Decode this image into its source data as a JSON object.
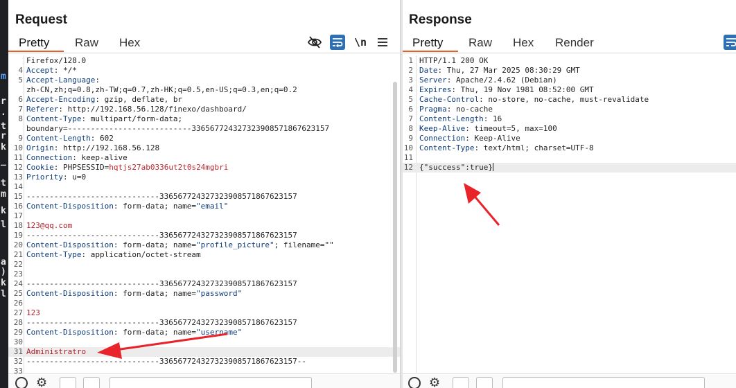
{
  "request": {
    "title": "Request",
    "tabs": [
      "Pretty",
      "Raw",
      "Hex"
    ],
    "active_tab": "Pretty",
    "lines": [
      {
        "n": "",
        "k": "",
        "v": "Firefox/128.0"
      },
      {
        "n": "4",
        "k": "Accept",
        "v": ": */*"
      },
      {
        "n": "5",
        "k": "Accept-Language",
        "v": ":"
      },
      {
        "n": "",
        "k": "",
        "v": "zh-CN,zh;q=0.8,zh-TW;q=0.7,zh-HK;q=0.5,en-US;q=0.3,en;q=0.2"
      },
      {
        "n": "6",
        "k": "Accept-Encoding",
        "v": ": gzip, deflate, br"
      },
      {
        "n": "7",
        "k": "Referer",
        "v": ": http://192.168.56.128/finexo/dashboard/"
      },
      {
        "n": "8",
        "k": "Content-Type",
        "v": ": multipart/form-data;"
      },
      {
        "n": "",
        "k": "",
        "v": "boundary=---------------------------336567724327323908571867623157"
      },
      {
        "n": "9",
        "k": "Content-Length",
        "v": ": 602"
      },
      {
        "n": "10",
        "k": "Origin",
        "v": ": http://192.168.56.128"
      },
      {
        "n": "11",
        "k": "Connection",
        "v": ": keep-alive"
      },
      {
        "n": "12",
        "k": "Cookie",
        "v": ": PHPSESSID=",
        "c": "hqtjs27ab0336ut2t0s24mgbri"
      },
      {
        "n": "13",
        "k": "Priority",
        "v": ": u=0"
      },
      {
        "n": "14",
        "k": "",
        "v": ""
      },
      {
        "n": "15",
        "k": "",
        "v": "-----------------------------336567724327323908571867623157"
      },
      {
        "n": "16",
        "k": "Content-Disposition",
        "v": ": form-data; name=",
        "q": "\"email\""
      },
      {
        "n": "17",
        "k": "",
        "v": ""
      },
      {
        "n": "18",
        "k": "",
        "v": "",
        "r": "123@qq.com"
      },
      {
        "n": "19",
        "k": "",
        "v": "-----------------------------336567724327323908571867623157"
      },
      {
        "n": "20",
        "k": "Content-Disposition",
        "v": ": form-data; name=",
        "q": "\"profile_picture\"",
        "t": "; filename=\"\""
      },
      {
        "n": "21",
        "k": "Content-Type",
        "v": ": application/octet-stream"
      },
      {
        "n": "22",
        "k": "",
        "v": ""
      },
      {
        "n": "23",
        "k": "",
        "v": ""
      },
      {
        "n": "24",
        "k": "",
        "v": "-----------------------------336567724327323908571867623157"
      },
      {
        "n": "25",
        "k": "Content-Disposition",
        "v": ": form-data; name=",
        "q": "\"password\""
      },
      {
        "n": "26",
        "k": "",
        "v": ""
      },
      {
        "n": "27",
        "k": "",
        "v": "",
        "r": "123"
      },
      {
        "n": "28",
        "k": "",
        "v": "-----------------------------336567724327323908571867623157"
      },
      {
        "n": "29",
        "k": "Content-Disposition",
        "v": ": form-data; name=",
        "q": "\"username\""
      },
      {
        "n": "30",
        "k": "",
        "v": ""
      },
      {
        "n": "31",
        "k": "",
        "v": "",
        "r": "Administratro",
        "hl": true
      },
      {
        "n": "32",
        "k": "",
        "v": "-----------------------------336567724327323908571867623157--"
      },
      {
        "n": "33",
        "k": "",
        "v": ""
      }
    ]
  },
  "response": {
    "title": "Response",
    "tabs": [
      "Pretty",
      "Raw",
      "Hex",
      "Render"
    ],
    "active_tab": "Pretty",
    "lines": [
      {
        "n": "1",
        "k": "",
        "v": "HTTP/1.1 200 OK"
      },
      {
        "n": "2",
        "k": "Date",
        "v": ": Thu, 27 Mar 2025 08:30:29 GMT"
      },
      {
        "n": "3",
        "k": "Server",
        "v": ": Apache/2.4.62 (Debian)"
      },
      {
        "n": "4",
        "k": "Expires",
        "v": ": Thu, 19 Nov 1981 08:52:00 GMT"
      },
      {
        "n": "5",
        "k": "Cache-Control",
        "v": ": no-store, no-cache, must-revalidate"
      },
      {
        "n": "6",
        "k": "Pragma",
        "v": ": no-cache"
      },
      {
        "n": "7",
        "k": "Content-Length",
        "v": ": 16"
      },
      {
        "n": "8",
        "k": "Keep-Alive",
        "v": ": timeout=5, max=100"
      },
      {
        "n": "9",
        "k": "Connection",
        "v": ": Keep-Alive"
      },
      {
        "n": "10",
        "k": "Content-Type",
        "v": ": text/html; charset=UTF-8"
      },
      {
        "n": "11",
        "k": "",
        "v": ""
      },
      {
        "n": "12",
        "k": "",
        "v": "{\"success\":true}",
        "hl": true,
        "cursor": true
      }
    ]
  },
  "colors": {
    "accent": "#e8622c",
    "toolbar_blue": "#2f6fb3",
    "arrow_red": "#e8242a"
  },
  "icons": [
    "visibility-off-icon",
    "wrap-lines-icon",
    "newline-icon",
    "menu-icon",
    "help-icon",
    "settings-icon"
  ],
  "left_strip_glyphs": [
    "m",
    "r",
    ".",
    "t",
    "r",
    "k",
    "_",
    "t",
    "m",
    "k",
    "l",
    "a",
    ")",
    "k",
    "l"
  ]
}
